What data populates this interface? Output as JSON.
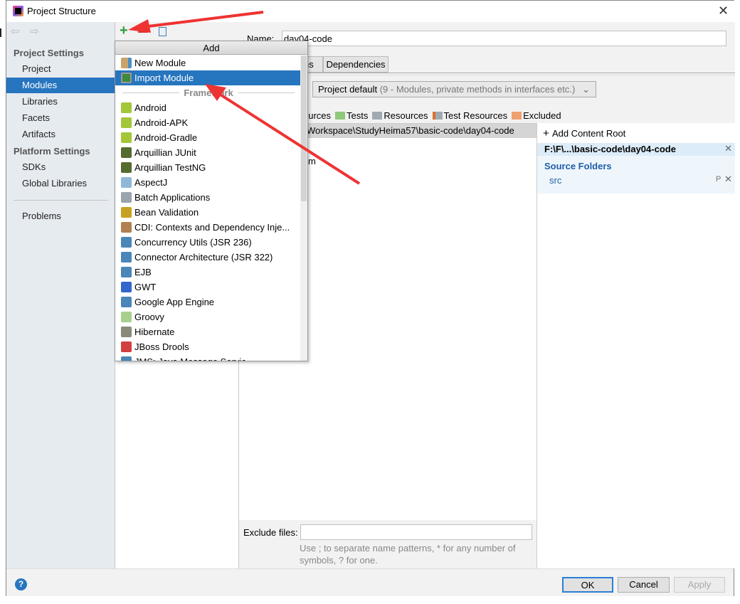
{
  "window": {
    "title": "Project Structure"
  },
  "sidebar": {
    "project_settings": "Project Settings",
    "items": [
      "Project",
      "Modules",
      "Libraries",
      "Facets",
      "Artifacts"
    ],
    "platform_settings": "Platform Settings",
    "platform_items": [
      "SDKs",
      "Global Libraries"
    ],
    "problems": "Problems",
    "selected": "Modules"
  },
  "popup": {
    "title": "Add",
    "items": [
      {
        "label": "New Module",
        "icon": "module-folder-icon"
      },
      {
        "label": "Import Module",
        "icon": "import-module-icon"
      }
    ],
    "separator": "Framework",
    "frameworks": [
      {
        "label": "Android",
        "icon": "android-folder-icon",
        "color": "#a4c639"
      },
      {
        "label": "Android-APK",
        "icon": "android-icon",
        "color": "#a4c639"
      },
      {
        "label": "Android-Gradle",
        "icon": "android-icon",
        "color": "#a4c639"
      },
      {
        "label": "Arquillian JUnit",
        "icon": "arquillian-icon",
        "color": "#556b2f"
      },
      {
        "label": "Arquillian TestNG",
        "icon": "arquillian-icon",
        "color": "#556b2f"
      },
      {
        "label": "AspectJ",
        "icon": "aspectj-icon",
        "color": "#8fb8d8"
      },
      {
        "label": "Batch Applications",
        "icon": "batch-icon",
        "color": "#9aa4ad"
      },
      {
        "label": "Bean Validation",
        "icon": "bean-validation-icon",
        "color": "#c8a020"
      },
      {
        "label": "CDI: Contexts and Dependency Inje...",
        "icon": "cdi-icon",
        "color": "#b08050"
      },
      {
        "label": "Concurrency Utils (JSR 236)",
        "icon": "jee-icon",
        "color": "#4a86b8"
      },
      {
        "label": "Connector Architecture (JSR 322)",
        "icon": "jee-icon",
        "color": "#4a86b8"
      },
      {
        "label": "EJB",
        "icon": "ejb-icon",
        "color": "#4a86b8"
      },
      {
        "label": "GWT",
        "icon": "gwt-icon",
        "color": "#3366cc"
      },
      {
        "label": "Google App Engine",
        "icon": "app-engine-icon",
        "color": "#4a86b8"
      },
      {
        "label": "Groovy",
        "icon": "groovy-icon",
        "color": "#a8d08d"
      },
      {
        "label": "Hibernate",
        "icon": "hibernate-icon",
        "color": "#8a8a7a"
      },
      {
        "label": "JBoss Drools",
        "icon": "drools-icon",
        "color": "#d04040"
      },
      {
        "label": "JMS: Java Message Servic",
        "icon": "jee-icon",
        "color": "#4a86b8"
      }
    ]
  },
  "main": {
    "name_label": "Name:",
    "name_value": "day04-code",
    "tabs": [
      "ns",
      "Dependencies"
    ],
    "language_level": "Project default",
    "language_level_hint": " (9 - Modules, private methods in interfaces etc.)",
    "legend": [
      {
        "label": "ources",
        "color": ""
      },
      {
        "label": "Tests",
        "color": "#8fc97a"
      },
      {
        "label": "Resources",
        "color": "#a0aab2"
      },
      {
        "label": "Test Resources",
        "color": "#a0aab2"
      },
      {
        "label": "Excluded",
        "color": "#f0a070"
      }
    ],
    "tree_path": "Workspace\\StudyHeima57\\basic-code\\day04-code",
    "tree_fragment": "m",
    "add_content_root": "Add Content Root",
    "content_root": "F:\\F\\...\\basic-code\\day04-code",
    "source_folders": "Source Folders",
    "src": "src",
    "src_actions": "P",
    "exclude_label": "Exclude files:",
    "exclude_value": "",
    "exclude_hint": "Use ; to separate name patterns, * for any number of symbols, ? for one."
  },
  "buttons": {
    "ok": "OK",
    "cancel": "Cancel",
    "apply": "Apply",
    "help": "?"
  },
  "colors": {
    "selection": "#2675bf",
    "annotation_arrow": "#ee3333"
  }
}
